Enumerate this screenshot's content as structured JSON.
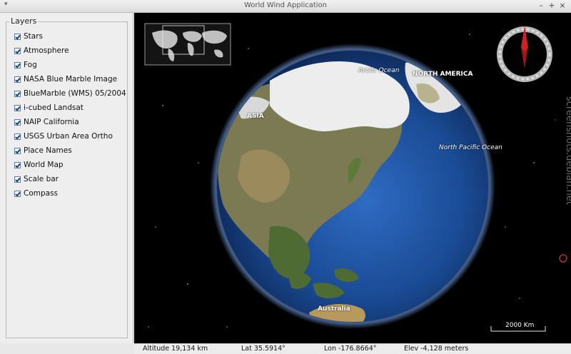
{
  "window": {
    "title": "World Wind Application"
  },
  "layers": {
    "title": "Layers",
    "items": [
      {
        "label": "Stars",
        "checked": true
      },
      {
        "label": "Atmosphere",
        "checked": true
      },
      {
        "label": "Fog",
        "checked": true
      },
      {
        "label": "NASA Blue Marble Image",
        "checked": true
      },
      {
        "label": "BlueMarble (WMS) 05/2004",
        "checked": true
      },
      {
        "label": "i-cubed Landsat",
        "checked": true
      },
      {
        "label": "NAIP California",
        "checked": true
      },
      {
        "label": "USGS Urban Area Ortho",
        "checked": true
      },
      {
        "label": "Place Names",
        "checked": true
      },
      {
        "label": "World Map",
        "checked": true
      },
      {
        "label": "Scale bar",
        "checked": true
      },
      {
        "label": "Compass",
        "checked": true
      }
    ]
  },
  "globe": {
    "labels": {
      "arctic_ocean": "Arctic Ocean",
      "north_america": "NORTH AMERICA",
      "asia": "ASIA",
      "north_pacific": "North Pacific Ocean",
      "australia": "Australia"
    },
    "scale_bar": "2000 Km",
    "watermark": "screenshots.debian.net"
  },
  "status": {
    "altitude": "Altitude  19,134 km",
    "lat": "Lat  35.5914°",
    "lon": "Lon  -176.8664°",
    "elev": "Elev  -4,128 meters"
  },
  "colors": {
    "ocean": "#1d4f9a",
    "space": "#000000",
    "compass_needle": "#cc2222"
  }
}
